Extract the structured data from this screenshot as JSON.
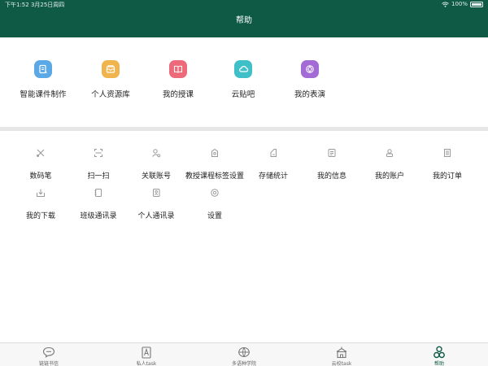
{
  "status_bar": {
    "left_text": "下午1:52  3月25日周四",
    "right_text": "100%"
  },
  "header": {
    "title": "帮助"
  },
  "main_items": [
    {
      "label": "智能课件制作",
      "icon": "courseware-icon",
      "color": "#5aa9e6"
    },
    {
      "label": "个人资源库",
      "icon": "resource-box-icon",
      "color": "#f0b44c"
    },
    {
      "label": "我的授课",
      "icon": "book-icon",
      "color": "#ec6a7a"
    },
    {
      "label": "云贴吧",
      "icon": "cloud-icon",
      "color": "#3fc0c9"
    },
    {
      "label": "我的表演",
      "icon": "performance-icon",
      "color": "#a36bd6"
    }
  ],
  "secondary_items": [
    {
      "label": "数码笔",
      "icon": "pen-tools-icon"
    },
    {
      "label": "扫一扫",
      "icon": "scan-icon"
    },
    {
      "label": "关联账号",
      "icon": "linked-account-icon"
    },
    {
      "label": "教授课程标签设置",
      "icon": "tag-settings-icon"
    },
    {
      "label": "存储统计",
      "icon": "storage-icon"
    },
    {
      "label": "我的信息",
      "icon": "info-icon"
    },
    {
      "label": "我的账户",
      "icon": "account-icon"
    },
    {
      "label": "我的订单",
      "icon": "order-icon"
    },
    {
      "label": "我的下载",
      "icon": "download-icon"
    },
    {
      "label": "班级通讯录",
      "icon": "class-contacts-icon"
    },
    {
      "label": "个人通讯录",
      "icon": "personal-contacts-icon"
    },
    {
      "label": "设置",
      "icon": "settings-icon"
    }
  ],
  "tabs": [
    {
      "label": "链链书信",
      "icon": "chat-bubble-icon",
      "active": false
    },
    {
      "label": "私人task",
      "icon": "letter-card-icon",
      "active": false
    },
    {
      "label": "多语种学院",
      "icon": "globe-icon",
      "active": false
    },
    {
      "label": "云校task",
      "icon": "school-building-icon",
      "active": false
    },
    {
      "label": "帮助",
      "icon": "help-people-icon",
      "active": true
    }
  ],
  "colors": {
    "header_bg": "#0f5a45",
    "active_tab": "#0f5a45",
    "inactive_icon": "#9a9a9a"
  }
}
